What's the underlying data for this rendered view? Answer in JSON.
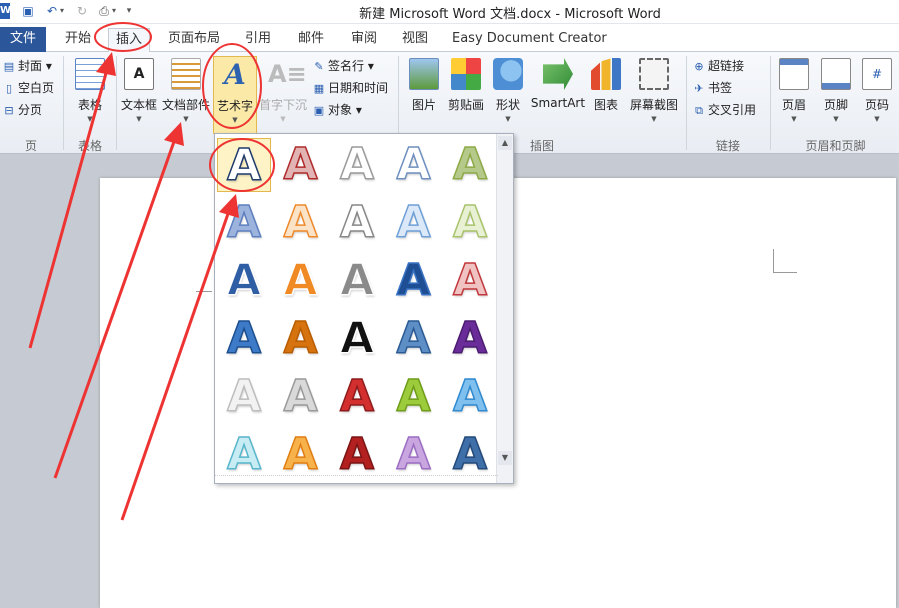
{
  "titlebar": {
    "title": "新建 Microsoft Word 文档.docx  -  Microsoft Word",
    "logo_letter": "W",
    "icons": [
      "save-icon",
      "undo-icon",
      "redo-icon",
      "print-preview-icon",
      "customize-icon"
    ]
  },
  "tabs": {
    "file": "文件",
    "home": "开始",
    "insert": "插入",
    "layout": "页面布局",
    "references": "引用",
    "mailings": "邮件",
    "review": "审阅",
    "view": "视图",
    "easy": "Easy Document Creator"
  },
  "ribbon": {
    "pages": {
      "cover": "封面",
      "blank": "空白页",
      "break": "分页",
      "group": "页"
    },
    "table": {
      "label": "表格",
      "group": "表格"
    },
    "text": {
      "textbox": "文本框",
      "quickparts": "文档部件",
      "wordart": "艺术字",
      "dropcap": "首字下沉",
      "signature": "签名行",
      "datetime": "日期和时间",
      "object": "对象"
    },
    "illustrations": {
      "picture": "图片",
      "clipart": "剪贴画",
      "shapes": "形状",
      "smartart": "SmartArt",
      "chart": "图表",
      "screenshot": "屏幕截图",
      "group": "插图"
    },
    "links": {
      "hyperlink": "超链接",
      "bookmark": "书签",
      "crossref": "交叉引用",
      "group": "链接"
    },
    "headerfooter": {
      "header": "页眉",
      "footer": "页脚",
      "pagenumber": "页码",
      "group": "页眉和页脚"
    }
  },
  "gallery": {
    "letter": "A",
    "styles": [
      {
        "fill": "#ffffff",
        "stroke": "#1f3b6b"
      },
      {
        "fill": "#e2b3b3",
        "stroke": "#b02a2a"
      },
      {
        "fill": "#ffffff",
        "stroke": "#9a9a9a"
      },
      {
        "fill": "#ffffff",
        "stroke": "#6e8fbf"
      },
      {
        "fill": "#b5c98a",
        "stroke": "#8eaa46"
      },
      {
        "fill": "#9cb4dd",
        "stroke": "#5e7fbf"
      },
      {
        "fill": "#fbe3c8",
        "stroke": "#ee8a2c"
      },
      {
        "fill": "#ffffff",
        "stroke": "#888888"
      },
      {
        "fill": "#dbe8f7",
        "stroke": "#6ea0d8"
      },
      {
        "fill": "#e9f1d5",
        "stroke": "#a9c36b"
      },
      {
        "fill": "#2f5ea5",
        "stroke": "#ffffff"
      },
      {
        "fill": "#f08a24",
        "stroke": "#ffffff"
      },
      {
        "fill": "#8a8a8a",
        "stroke": "#ffffff"
      },
      {
        "fill": "#1e4f95",
        "stroke": "#3a73c4"
      },
      {
        "fill": "#f1c2c2",
        "stroke": "#c0383c"
      },
      {
        "fill": "#3d7bc8",
        "stroke": "#1c4f8f"
      },
      {
        "fill": "#d6730f",
        "stroke": "#b85c00"
      },
      {
        "fill": "#111111",
        "stroke": "#ffffff"
      },
      {
        "fill": "#5d8ec5",
        "stroke": "#2b5a94"
      },
      {
        "fill": "#6a2c99",
        "stroke": "#4b1c70"
      },
      {
        "fill": "#f2f2f2",
        "stroke": "#bdbdbd"
      },
      {
        "fill": "#d9d9d9",
        "stroke": "#9a9a9a"
      },
      {
        "fill": "#d32f2f",
        "stroke": "#8e1b1b"
      },
      {
        "fill": "#9ccc3c",
        "stroke": "#6f9c19"
      },
      {
        "fill": "#7fc0ee",
        "stroke": "#2f8ad0"
      },
      {
        "fill": "#c8ecf3",
        "stroke": "#58b6cc"
      },
      {
        "fill": "#f7b24c",
        "stroke": "#e07e10"
      },
      {
        "fill": "#b2201f",
        "stroke": "#7a1414"
      },
      {
        "fill": "#c9a6df",
        "stroke": "#9b6dc3"
      },
      {
        "fill": "#3e6fa8",
        "stroke": "#23497a"
      }
    ]
  }
}
